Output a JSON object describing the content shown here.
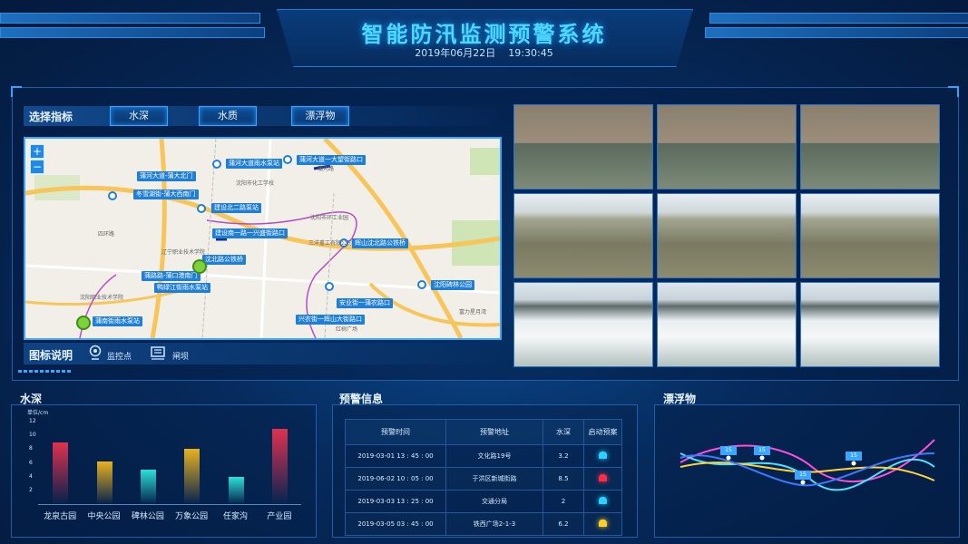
{
  "header": {
    "title": "智能防汛监测预警系统",
    "date": "2019年06月22日",
    "time": "19:30:45"
  },
  "indicator": {
    "label": "选择指标",
    "tabs": [
      "水深",
      "水质",
      "漂浮物"
    ]
  },
  "map": {
    "zoom_in": "+",
    "zoom_out": "−",
    "labels": [
      "蒲河大道雨水泵站",
      "蒲河大道一大望街路口",
      "蒲河大道-蒲大北门",
      "冬雪湖街-蒲大西南门",
      "建设北二路泵站",
      "建设南一路一兴盛街路口",
      "沈北路公铁桥",
      "辉山沈北路公铁桥",
      "蒲路路-蒲口港南门",
      "鸭绿江街雨水泵站",
      "沈阳碑林公园",
      "安业街一蒲农路口",
      "兴农街一辉山大街路口",
      "蒲南街雨水泵站"
    ],
    "places": [
      "沈阳市化工学校",
      "沈阳市环工业园",
      "三洋重工有限公司",
      "辽宁职业技术学院",
      "沈阳职业技术学院",
      "富力星月湾",
      "红树广场",
      "蒲河路",
      "四环路"
    ]
  },
  "legend": {
    "title": "图标说明",
    "items": [
      {
        "icon": "monitor-point-icon",
        "label": "监控点"
      },
      {
        "icon": "sluice-gate-icon",
        "label": "闸坝"
      }
    ]
  },
  "water_depth": {
    "title": "水深",
    "unit": "单位/cm",
    "chart_data": {
      "type": "bar",
      "categories": [
        "龙泉古园",
        "中央公园",
        "碑林公园",
        "万象公园",
        "任家沟",
        "产业园"
      ],
      "values": [
        9,
        6.2,
        5,
        8.1,
        4,
        11
      ],
      "yticks": [
        2,
        4,
        6,
        8,
        10,
        12
      ],
      "ylim": [
        0,
        12
      ],
      "colors": [
        "#e0314f",
        "#e8b21f",
        "#2ee0d8",
        "#e8b21f",
        "#2ee0d8",
        "#e0314f"
      ]
    }
  },
  "warning": {
    "title": "预警信息",
    "columns": [
      "预警时间",
      "预警地址",
      "水深",
      "启动预案"
    ],
    "rows": [
      {
        "time": "2019-03-01 13 : 45 : 00",
        "addr": "文化路19号",
        "depth": "3.2",
        "alarm": "#2fd0ff"
      },
      {
        "time": "2019-06-02 10 : 05 : 00",
        "addr": "于洪区新城街路",
        "depth": "8.5",
        "alarm": "#ff2c4a"
      },
      {
        "time": "2019-03-03 13 : 25 : 00",
        "addr": "交通分局",
        "depth": "2",
        "alarm": "#2fd0ff"
      },
      {
        "time": "2019-03-05 03 : 45 : 00",
        "addr": "铁西广场2-1-3",
        "depth": "6.2",
        "alarm": "#ffcf2a"
      }
    ]
  },
  "floating": {
    "title": "漂浮物",
    "badges": [
      "15",
      "15",
      "15",
      "15"
    ]
  }
}
